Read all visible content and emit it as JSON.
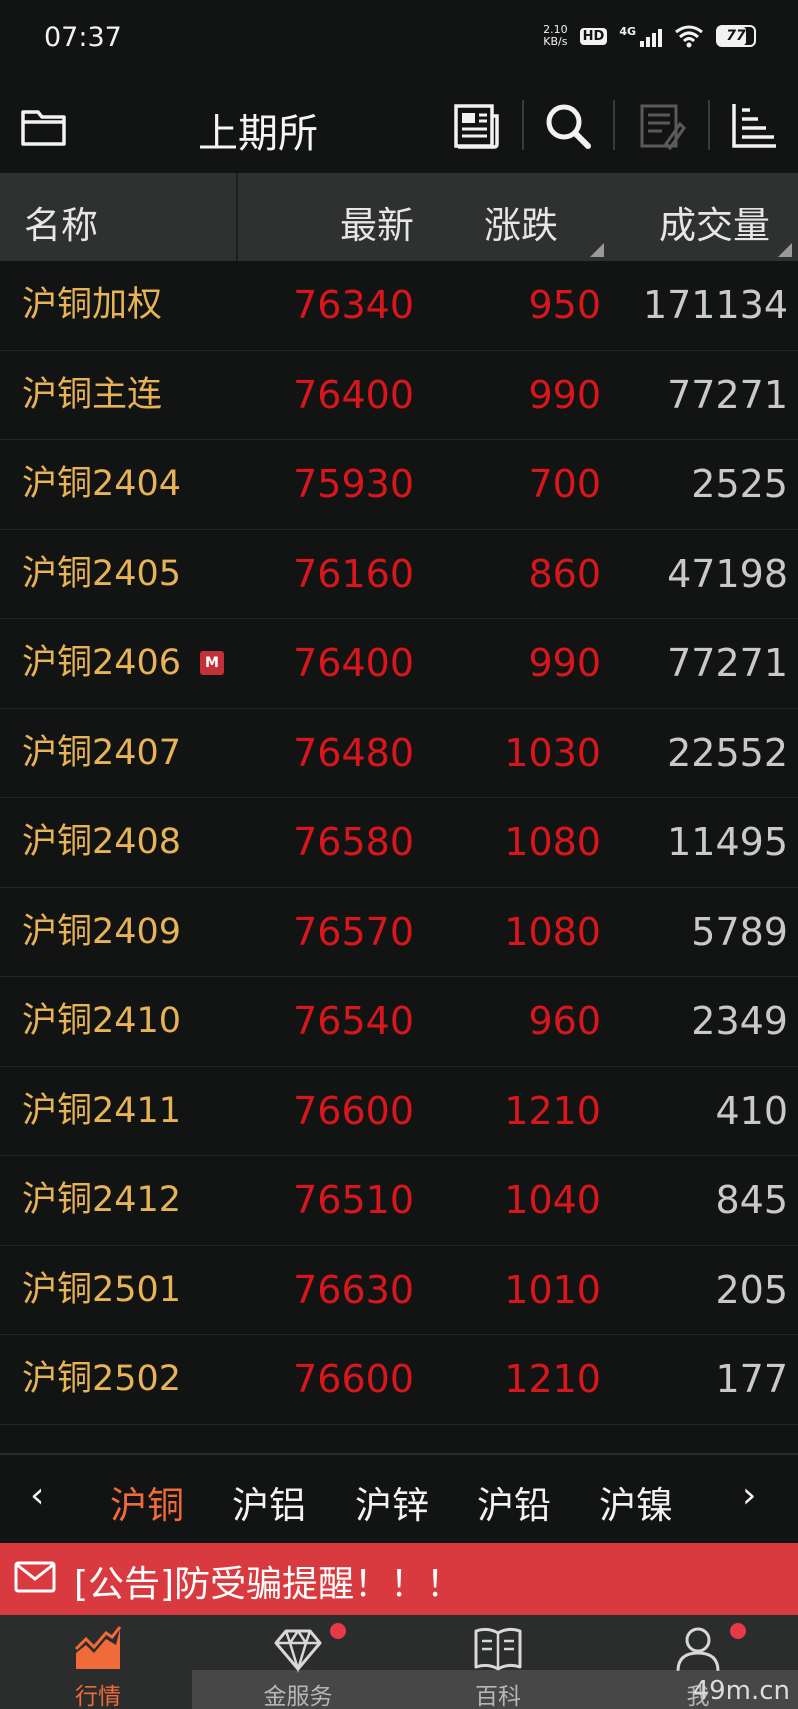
{
  "status": {
    "time": "07:37",
    "net_speed_value": "2.10",
    "net_speed_unit": "KB/s",
    "hd": "HD",
    "network": "4G",
    "battery": "77"
  },
  "topbar": {
    "title": "上期所"
  },
  "header": {
    "name": "名称",
    "latest": "最新",
    "change": "涨跌",
    "volume": "成交量"
  },
  "rows": [
    {
      "name": "沪铜加权",
      "latest": "76340",
      "change": "950",
      "volume": "171134"
    },
    {
      "name": "沪铜主连",
      "latest": "76400",
      "change": "990",
      "volume": "77271"
    },
    {
      "name": "沪铜2404",
      "latest": "75930",
      "change": "700",
      "volume": "2525"
    },
    {
      "name": "沪铜2405",
      "latest": "76160",
      "change": "860",
      "volume": "47198"
    },
    {
      "name": "沪铜2406",
      "badge": "M",
      "latest": "76400",
      "change": "990",
      "volume": "77271"
    },
    {
      "name": "沪铜2407",
      "latest": "76480",
      "change": "1030",
      "volume": "22552"
    },
    {
      "name": "沪铜2408",
      "latest": "76580",
      "change": "1080",
      "volume": "11495"
    },
    {
      "name": "沪铜2409",
      "latest": "76570",
      "change": "1080",
      "volume": "5789"
    },
    {
      "name": "沪铜2410",
      "latest": "76540",
      "change": "960",
      "volume": "2349"
    },
    {
      "name": "沪铜2411",
      "latest": "76600",
      "change": "1210",
      "volume": "410"
    },
    {
      "name": "沪铜2412",
      "latest": "76510",
      "change": "1040",
      "volume": "845"
    },
    {
      "name": "沪铜2501",
      "latest": "76630",
      "change": "1010",
      "volume": "205"
    },
    {
      "name": "沪铜2502",
      "latest": "76600",
      "change": "1210",
      "volume": "177"
    }
  ],
  "commodities": {
    "prev": "‹",
    "next": "›",
    "tabs": [
      "沪铜",
      "沪铝",
      "沪锌",
      "沪铅",
      "沪镍"
    ],
    "active": "沪铜"
  },
  "notice": {
    "text": "[公告]防受骗提醒！！！"
  },
  "tabbar": {
    "tabs": [
      "行情",
      "金服务",
      "百科",
      "我"
    ]
  },
  "watermark": "49m.cn",
  "colors": {
    "up": "#d9161b",
    "name": "#e8b256",
    "active_tab": "#f06a3a",
    "notice_bg": "#d93a3f"
  }
}
